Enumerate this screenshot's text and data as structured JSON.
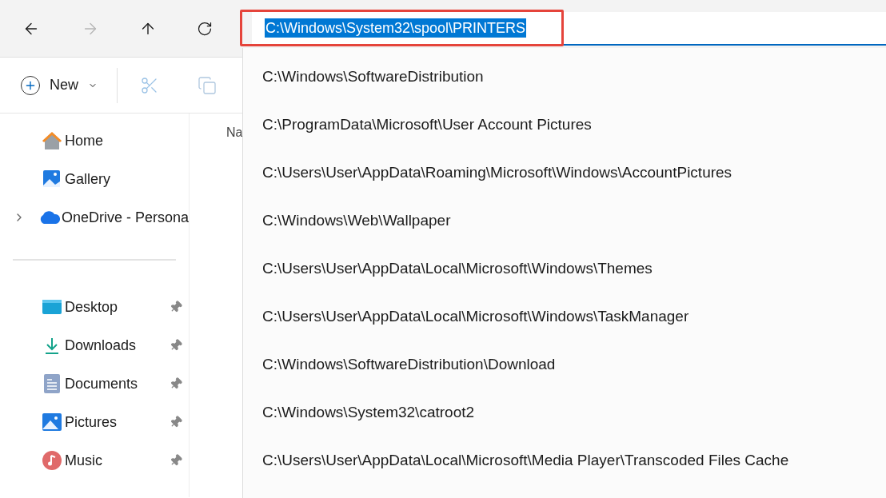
{
  "address_bar": {
    "value": "C:\\Windows\\System32\\spool\\PRINTERS",
    "selected": true,
    "highlighted": true
  },
  "toolbar": {
    "new_label": "New"
  },
  "sidebar": {
    "groups": [
      {
        "items": [
          {
            "label": "Home"
          },
          {
            "label": "Gallery"
          },
          {
            "label": "OneDrive - Persona",
            "expanded": false
          }
        ]
      },
      {
        "items": [
          {
            "label": "Desktop",
            "pinned": true
          },
          {
            "label": "Downloads",
            "pinned": true
          },
          {
            "label": "Documents",
            "pinned": true
          },
          {
            "label": "Pictures",
            "pinned": true
          },
          {
            "label": "Music",
            "pinned": true
          }
        ]
      }
    ]
  },
  "content": {
    "column_1": "Na"
  },
  "suggestions": [
    "C:\\Windows\\SoftwareDistribution",
    "C:\\ProgramData\\Microsoft\\User Account Pictures",
    "C:\\Users\\User\\AppData\\Roaming\\Microsoft\\Windows\\AccountPictures",
    "C:\\Windows\\Web\\Wallpaper",
    "C:\\Users\\User\\AppData\\Local\\Microsoft\\Windows\\Themes",
    "C:\\Users\\User\\AppData\\Local\\Microsoft\\Windows\\TaskManager",
    "C:\\Windows\\SoftwareDistribution\\Download",
    "C:\\Windows\\System32\\catroot2",
    "C:\\Users\\User\\AppData\\Local\\Microsoft\\Media Player\\Transcoded Files Cache"
  ]
}
